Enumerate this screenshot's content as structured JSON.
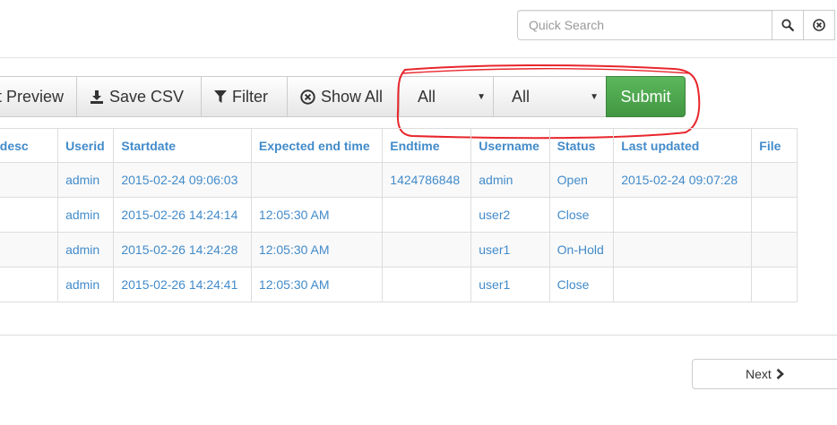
{
  "search": {
    "placeholder": "Quick Search",
    "search_icon": "search-icon",
    "clear_icon": "clear-circle-icon"
  },
  "toolbar": {
    "preview_label": "t Preview",
    "save_csv_label": "Save CSV",
    "filter_label": "Filter",
    "show_all_label": "Show All",
    "select1_value": "All",
    "select2_value": "All",
    "submit_label": "Submit"
  },
  "annotation_color": "#e8262c",
  "table": {
    "headers": [
      "Task desc",
      "Userid",
      "Startdate",
      "Expected end time",
      "Endtime",
      "Username",
      "Status",
      "Last updated",
      "File"
    ],
    "rows": [
      [
        "",
        "admin",
        "2015-02-24 09:06:03",
        "",
        "1424786848",
        "admin",
        "Open",
        "2015-02-24 09:07:28",
        ""
      ],
      [
        "",
        "admin",
        "2015-02-26 14:24:14",
        "12:05:30 AM",
        "",
        "user2",
        "Close",
        "",
        ""
      ],
      [
        "",
        "admin",
        "2015-02-26 14:24:28",
        "12:05:30 AM",
        "",
        "user1",
        "On-Hold",
        "",
        ""
      ],
      [
        "",
        "admin",
        "2015-02-26 14:24:41",
        "12:05:30 AM",
        "",
        "user1",
        "Close",
        "",
        ""
      ]
    ]
  },
  "pager": {
    "next_label": "Next"
  }
}
